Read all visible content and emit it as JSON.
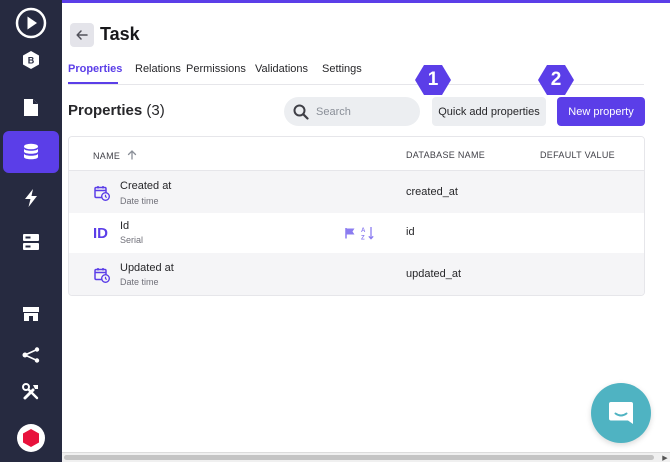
{
  "sidebar": {
    "items": [
      {
        "icon": "play-icon"
      },
      {
        "icon": "backend-hex-icon",
        "label": "B"
      },
      {
        "icon": "document-icon"
      },
      {
        "icon": "database-icon",
        "active": true
      },
      {
        "icon": "lightning-icon"
      },
      {
        "icon": "server-icon"
      },
      {
        "icon": "store-icon"
      },
      {
        "icon": "share-icon"
      },
      {
        "icon": "tools-icon"
      },
      {
        "icon": "brand-logo-icon"
      }
    ],
    "accent_color": "#5b3ee8",
    "background_color": "#262a40"
  },
  "header": {
    "back_icon": "arrow-left-icon",
    "title": "Task"
  },
  "tabs": [
    {
      "label": "Properties",
      "active": true
    },
    {
      "label": "Relations"
    },
    {
      "label": "Permissions"
    },
    {
      "label": "Validations"
    },
    {
      "label": "Settings"
    }
  ],
  "section": {
    "title": "Properties",
    "count": "(3)"
  },
  "search": {
    "placeholder": "Search",
    "value": ""
  },
  "buttons": {
    "quick_add": "Quick add properties",
    "new_property": "New property"
  },
  "callouts": [
    {
      "number": "1"
    },
    {
      "number": "2"
    }
  ],
  "table": {
    "columns": {
      "name": "NAME",
      "database_name": "DATABASE NAME",
      "default_value": "DEFAULT VALUE"
    },
    "sort_icon": "arrow-up-icon",
    "rows": [
      {
        "icon": "calendar-clock-icon",
        "name": "Created at",
        "type": "Date time",
        "database_name": "created_at"
      },
      {
        "icon": "id-icon",
        "icon_text": "ID",
        "name": "Id",
        "type": "Serial",
        "database_name": "id",
        "extra_icons": [
          "flag-icon",
          "sort-az-icon"
        ]
      },
      {
        "icon": "calendar-clock-icon",
        "name": "Updated at",
        "type": "Date time",
        "database_name": "updated_at"
      }
    ]
  },
  "chat": {
    "icon": "chat-bubble-icon",
    "color": "#4fb3c2"
  }
}
